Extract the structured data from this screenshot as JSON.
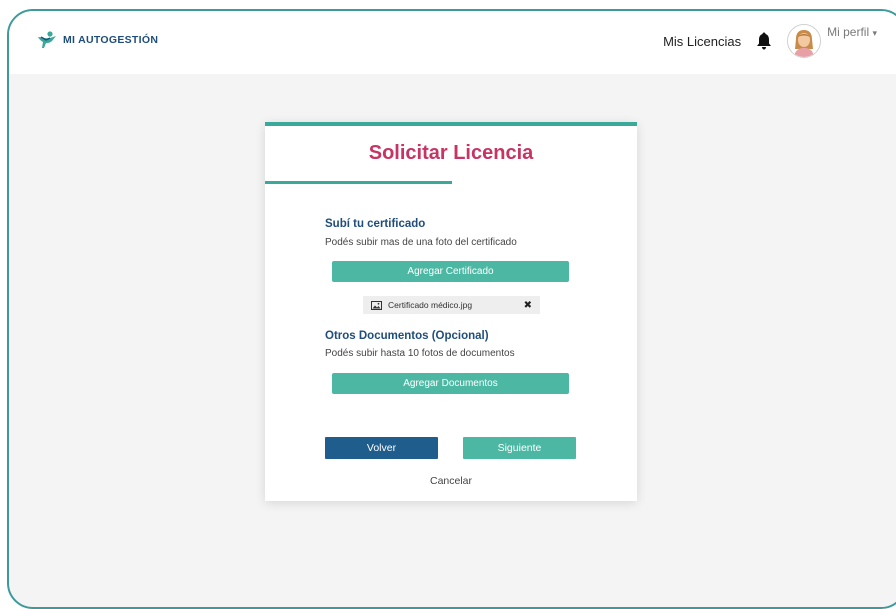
{
  "brand": {
    "name": "MI AUTOGESTIÓN"
  },
  "nav": {
    "licenses": "Mis Licencias",
    "profile": "Mi perfil",
    "caret": "▾"
  },
  "card": {
    "title": "Solicitar Licencia",
    "certificate": {
      "title": "Subí tu certificado",
      "subtitle": "Podés subir mas de una foto del certificado",
      "button": "Agregar Certificado",
      "file": {
        "name": "Certificado médico.jpg",
        "remove": "✖"
      }
    },
    "documents": {
      "title": "Otros Documentos (Opcional)",
      "subtitle": "Podés subir hasta 10 fotos de documentos",
      "button": "Agregar Documentos"
    },
    "back": "Volver",
    "next": "Siguiente",
    "cancel": "Cancelar"
  },
  "colors": {
    "brand_navy": "#1f4e7a",
    "teal": "#4cb8a3",
    "accent_line": "#3aa99a",
    "title_pink": "#c73362",
    "back_button": "#1e5d8c",
    "frame_border": "#3e9a9a",
    "background": "#f4f4f4"
  },
  "icons": {
    "logo": "person-logo-icon",
    "bell": "bell-icon",
    "avatar": "avatar-icon",
    "file": "image-file-icon",
    "remove": "close-icon"
  }
}
